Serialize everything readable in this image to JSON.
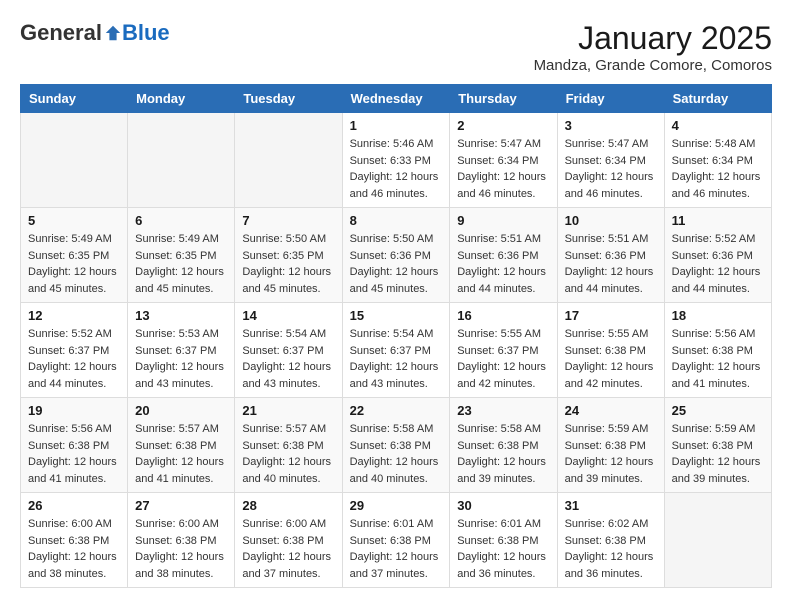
{
  "header": {
    "logo_general": "General",
    "logo_blue": "Blue",
    "month_title": "January 2025",
    "subtitle": "Mandza, Grande Comore, Comoros"
  },
  "weekdays": [
    "Sunday",
    "Monday",
    "Tuesday",
    "Wednesday",
    "Thursday",
    "Friday",
    "Saturday"
  ],
  "weeks": [
    [
      {
        "day": "",
        "info": ""
      },
      {
        "day": "",
        "info": ""
      },
      {
        "day": "",
        "info": ""
      },
      {
        "day": "1",
        "info": "Sunrise: 5:46 AM\nSunset: 6:33 PM\nDaylight: 12 hours\nand 46 minutes."
      },
      {
        "day": "2",
        "info": "Sunrise: 5:47 AM\nSunset: 6:34 PM\nDaylight: 12 hours\nand 46 minutes."
      },
      {
        "day": "3",
        "info": "Sunrise: 5:47 AM\nSunset: 6:34 PM\nDaylight: 12 hours\nand 46 minutes."
      },
      {
        "day": "4",
        "info": "Sunrise: 5:48 AM\nSunset: 6:34 PM\nDaylight: 12 hours\nand 46 minutes."
      }
    ],
    [
      {
        "day": "5",
        "info": "Sunrise: 5:49 AM\nSunset: 6:35 PM\nDaylight: 12 hours\nand 45 minutes."
      },
      {
        "day": "6",
        "info": "Sunrise: 5:49 AM\nSunset: 6:35 PM\nDaylight: 12 hours\nand 45 minutes."
      },
      {
        "day": "7",
        "info": "Sunrise: 5:50 AM\nSunset: 6:35 PM\nDaylight: 12 hours\nand 45 minutes."
      },
      {
        "day": "8",
        "info": "Sunrise: 5:50 AM\nSunset: 6:36 PM\nDaylight: 12 hours\nand 45 minutes."
      },
      {
        "day": "9",
        "info": "Sunrise: 5:51 AM\nSunset: 6:36 PM\nDaylight: 12 hours\nand 44 minutes."
      },
      {
        "day": "10",
        "info": "Sunrise: 5:51 AM\nSunset: 6:36 PM\nDaylight: 12 hours\nand 44 minutes."
      },
      {
        "day": "11",
        "info": "Sunrise: 5:52 AM\nSunset: 6:36 PM\nDaylight: 12 hours\nand 44 minutes."
      }
    ],
    [
      {
        "day": "12",
        "info": "Sunrise: 5:52 AM\nSunset: 6:37 PM\nDaylight: 12 hours\nand 44 minutes."
      },
      {
        "day": "13",
        "info": "Sunrise: 5:53 AM\nSunset: 6:37 PM\nDaylight: 12 hours\nand 43 minutes."
      },
      {
        "day": "14",
        "info": "Sunrise: 5:54 AM\nSunset: 6:37 PM\nDaylight: 12 hours\nand 43 minutes."
      },
      {
        "day": "15",
        "info": "Sunrise: 5:54 AM\nSunset: 6:37 PM\nDaylight: 12 hours\nand 43 minutes."
      },
      {
        "day": "16",
        "info": "Sunrise: 5:55 AM\nSunset: 6:37 PM\nDaylight: 12 hours\nand 42 minutes."
      },
      {
        "day": "17",
        "info": "Sunrise: 5:55 AM\nSunset: 6:38 PM\nDaylight: 12 hours\nand 42 minutes."
      },
      {
        "day": "18",
        "info": "Sunrise: 5:56 AM\nSunset: 6:38 PM\nDaylight: 12 hours\nand 41 minutes."
      }
    ],
    [
      {
        "day": "19",
        "info": "Sunrise: 5:56 AM\nSunset: 6:38 PM\nDaylight: 12 hours\nand 41 minutes."
      },
      {
        "day": "20",
        "info": "Sunrise: 5:57 AM\nSunset: 6:38 PM\nDaylight: 12 hours\nand 41 minutes."
      },
      {
        "day": "21",
        "info": "Sunrise: 5:57 AM\nSunset: 6:38 PM\nDaylight: 12 hours\nand 40 minutes."
      },
      {
        "day": "22",
        "info": "Sunrise: 5:58 AM\nSunset: 6:38 PM\nDaylight: 12 hours\nand 40 minutes."
      },
      {
        "day": "23",
        "info": "Sunrise: 5:58 AM\nSunset: 6:38 PM\nDaylight: 12 hours\nand 39 minutes."
      },
      {
        "day": "24",
        "info": "Sunrise: 5:59 AM\nSunset: 6:38 PM\nDaylight: 12 hours\nand 39 minutes."
      },
      {
        "day": "25",
        "info": "Sunrise: 5:59 AM\nSunset: 6:38 PM\nDaylight: 12 hours\nand 39 minutes."
      }
    ],
    [
      {
        "day": "26",
        "info": "Sunrise: 6:00 AM\nSunset: 6:38 PM\nDaylight: 12 hours\nand 38 minutes."
      },
      {
        "day": "27",
        "info": "Sunrise: 6:00 AM\nSunset: 6:38 PM\nDaylight: 12 hours\nand 38 minutes."
      },
      {
        "day": "28",
        "info": "Sunrise: 6:00 AM\nSunset: 6:38 PM\nDaylight: 12 hours\nand 37 minutes."
      },
      {
        "day": "29",
        "info": "Sunrise: 6:01 AM\nSunset: 6:38 PM\nDaylight: 12 hours\nand 37 minutes."
      },
      {
        "day": "30",
        "info": "Sunrise: 6:01 AM\nSunset: 6:38 PM\nDaylight: 12 hours\nand 36 minutes."
      },
      {
        "day": "31",
        "info": "Sunrise: 6:02 AM\nSunset: 6:38 PM\nDaylight: 12 hours\nand 36 minutes."
      },
      {
        "day": "",
        "info": ""
      }
    ]
  ]
}
